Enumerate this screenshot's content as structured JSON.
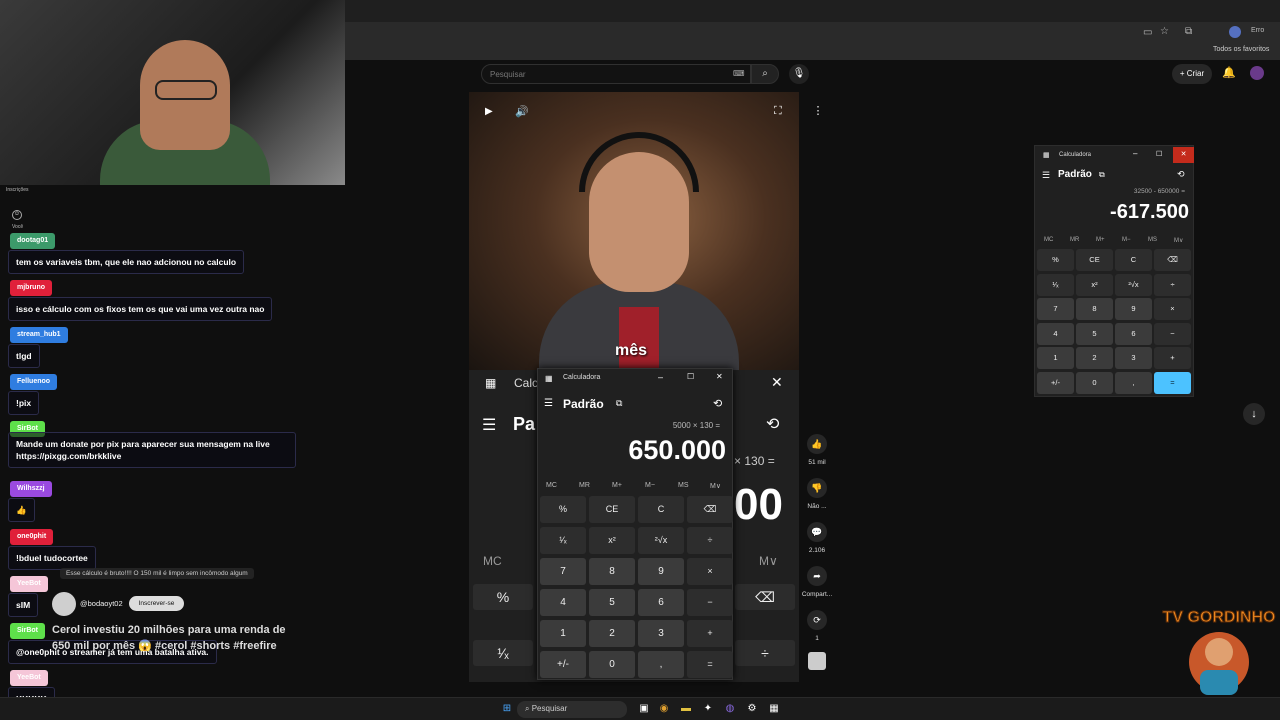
{
  "browser": {
    "profile_label": "Erro",
    "bookmarks_label": "Todos os favoritos"
  },
  "youtube": {
    "search_placeholder": "Pesquisar",
    "create_label": "Criar",
    "subtitle": "mês",
    "actions": {
      "likes": "51 mil",
      "dislike_label": "Não ...",
      "comments": "2.106",
      "share_label": "Compart...",
      "remix_count": "1"
    },
    "channel_handle": "@bodaoyt02",
    "subscribe_label": "Inscrever-se",
    "short_title": "Cerol investiu 20 milhões para uma renda de 650 mil por mês 😱 #cerol #shorts #freefire"
  },
  "video_calc": {
    "title": "Calc",
    "mode": "Pa",
    "expression": "× 130 =",
    "display": "00",
    "mem_left": "MC",
    "mem_right": "M∨"
  },
  "small_calc": {
    "title": "Calculadora",
    "mode": "Padrão",
    "expression": "5000 × 130 =",
    "display": "650.000",
    "memory": [
      "MC",
      "MR",
      "M+",
      "M−",
      "MS",
      "M∨"
    ],
    "buttons": [
      [
        "%",
        "CE",
        "C",
        "⌫"
      ],
      [
        "¹⁄ₓ",
        "x²",
        "²√x",
        "÷"
      ],
      [
        "7",
        "8",
        "9",
        "×"
      ],
      [
        "4",
        "5",
        "6",
        "−"
      ],
      [
        "1",
        "2",
        "3",
        "+"
      ],
      [
        "+/-",
        "0",
        ",",
        "="
      ]
    ]
  },
  "right_calc": {
    "title": "Calculadora",
    "mode": "Padrão",
    "expression": "32500 - 650000 =",
    "display": "-617.500",
    "memory": [
      "MC",
      "MR",
      "M+",
      "M−",
      "MS",
      "M∨"
    ],
    "buttons": [
      [
        "%",
        "CE",
        "C",
        "⌫"
      ],
      [
        "¹⁄ₓ",
        "x²",
        "²√x",
        "÷"
      ],
      [
        "7",
        "8",
        "9",
        "×"
      ],
      [
        "4",
        "5",
        "6",
        "−"
      ],
      [
        "1",
        "2",
        "3",
        "+"
      ],
      [
        "+/-",
        "0",
        ",",
        "="
      ]
    ],
    "accent": "#4cc2ff"
  },
  "chat": {
    "header_label": "Inscrições",
    "you_label": "Você",
    "messages": [
      {
        "user": "dootag01",
        "text": "tem os variaveis tbm, que ele nao adcionou no calculo",
        "color": "#3c9a6a"
      },
      {
        "user": "mjbruno",
        "text": "isso e cálculo com os fixos tem os que vai uma vez outra nao",
        "color": "#e0203a"
      },
      {
        "user": "stream_hub1",
        "text": "tlgd",
        "color": "#2f7de0"
      },
      {
        "user": "Felluenoo",
        "text": "!pix",
        "color": "#2f7de0"
      },
      {
        "user": "SirBot",
        "text": "Mande um donate por pix para aparecer sua mensagem na live https://pixgg.com/brkklive",
        "color": "#5ee04a"
      },
      {
        "user": "Wilhszzj",
        "text": "👍",
        "color": "#9a4ae0"
      },
      {
        "user": "one0phit",
        "text": "!bduel tudocortee",
        "color": "#e0203a"
      },
      {
        "user": "YeeBot",
        "text": "sIM",
        "color": "#f5c6d8"
      },
      {
        "user": "SirBot",
        "text": "@one0phit o streamer já tem uma batalha ativa.",
        "color": "#5ee04a"
      },
      {
        "user": "YeeBot",
        "text": "KKKKK",
        "color": "#f5c6d8"
      }
    ],
    "system_note": "Esse cálculo é bruto!!!! O 150 mil é limpo sem incômodo algum"
  },
  "taskbar": {
    "search_label": "Pesquisar"
  },
  "logo_text": "TV GORDINHO"
}
